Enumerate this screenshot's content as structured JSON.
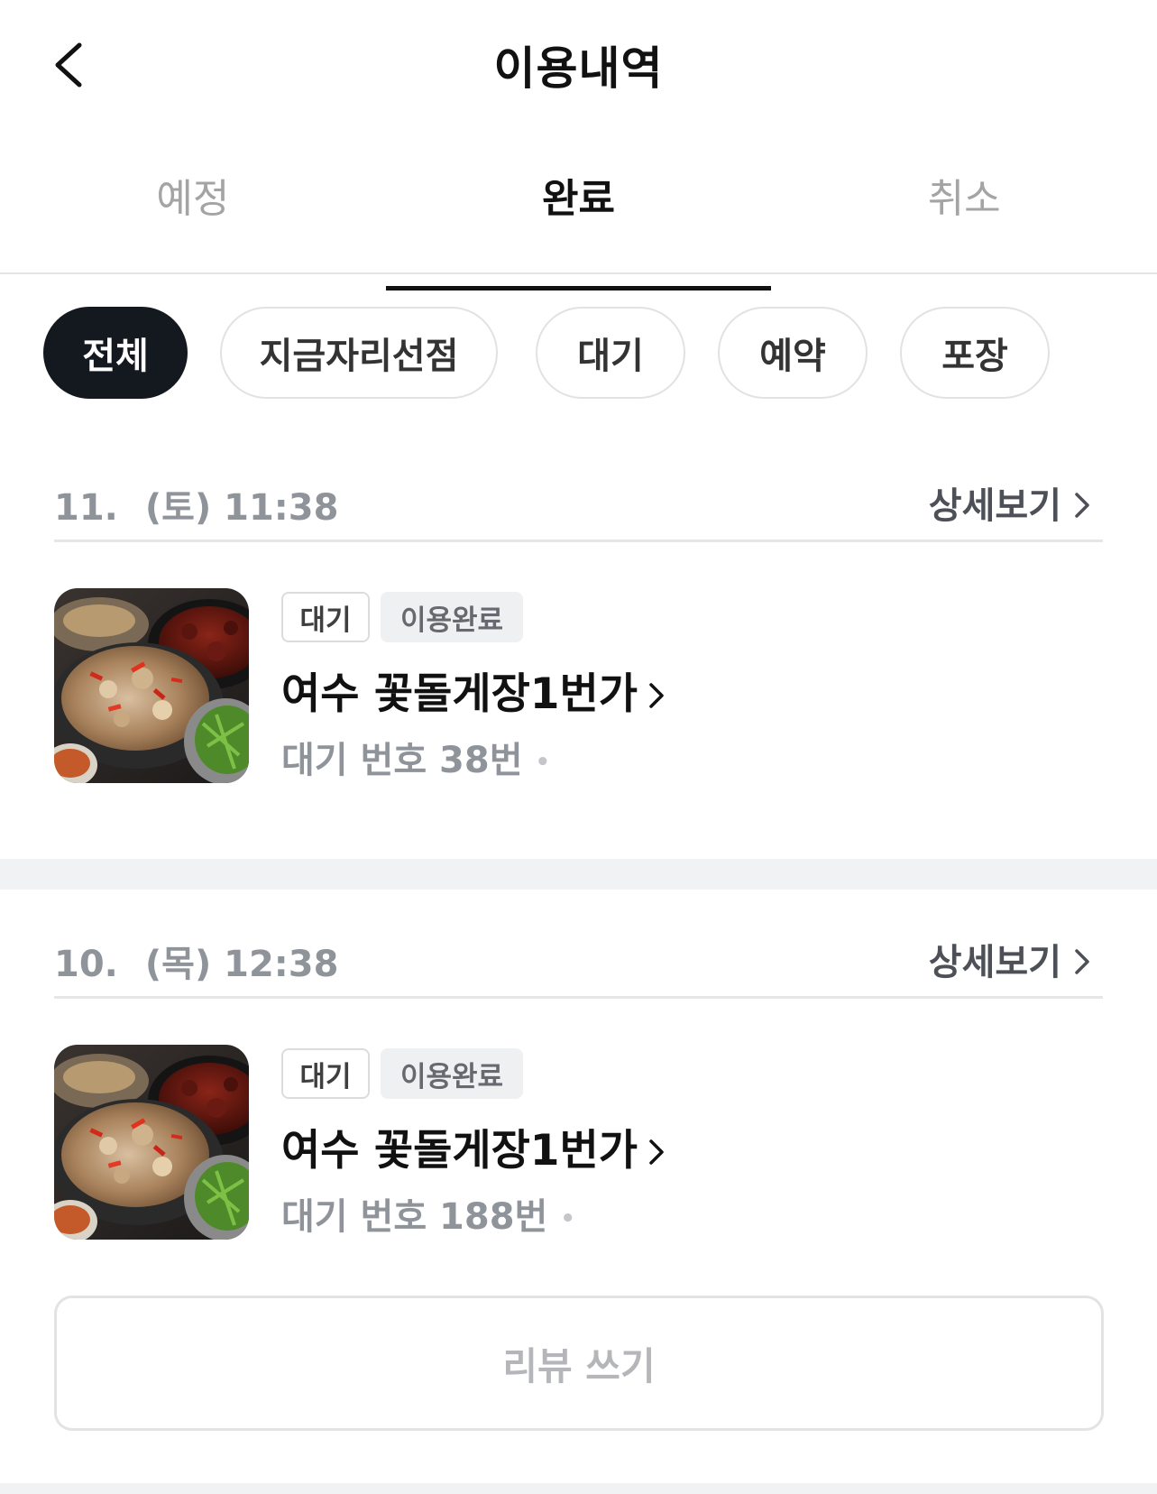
{
  "header": {
    "title": "이용내역",
    "back_icon": "chevron-left-icon"
  },
  "tabs": [
    {
      "label": "예정",
      "active": false
    },
    {
      "label": "완료",
      "active": true
    },
    {
      "label": "취소",
      "active": false
    }
  ],
  "filters": [
    {
      "label": "전체",
      "active": true
    },
    {
      "label": "지금자리선점",
      "active": false
    },
    {
      "label": "대기",
      "active": false
    },
    {
      "label": "예약",
      "active": false
    },
    {
      "label": "포장",
      "active": false
    }
  ],
  "records": [
    {
      "date_prefix": "11.",
      "date_rest": "(토) 11:38",
      "detail_label": "상세보기",
      "type_badge": "대기",
      "status_badge": "이용완료",
      "store_name": "여수 꽃돌게장1번가",
      "wait_number": "대기 번호 38번",
      "dot": "•",
      "thumbnail_icon": "food-photo"
    },
    {
      "date_prefix": "10.",
      "date_rest": "(목) 12:38",
      "detail_label": "상세보기",
      "type_badge": "대기",
      "status_badge": "이용완료",
      "store_name": "여수 꽃돌게장1번가",
      "wait_number": "대기 번호 188번",
      "dot": "•",
      "thumbnail_icon": "food-photo",
      "review_button": "리뷰 쓰기"
    }
  ],
  "colors": {
    "active_chip_bg": "#14181f",
    "muted_text": "#8f939a",
    "divider": "#f1f2f4"
  }
}
